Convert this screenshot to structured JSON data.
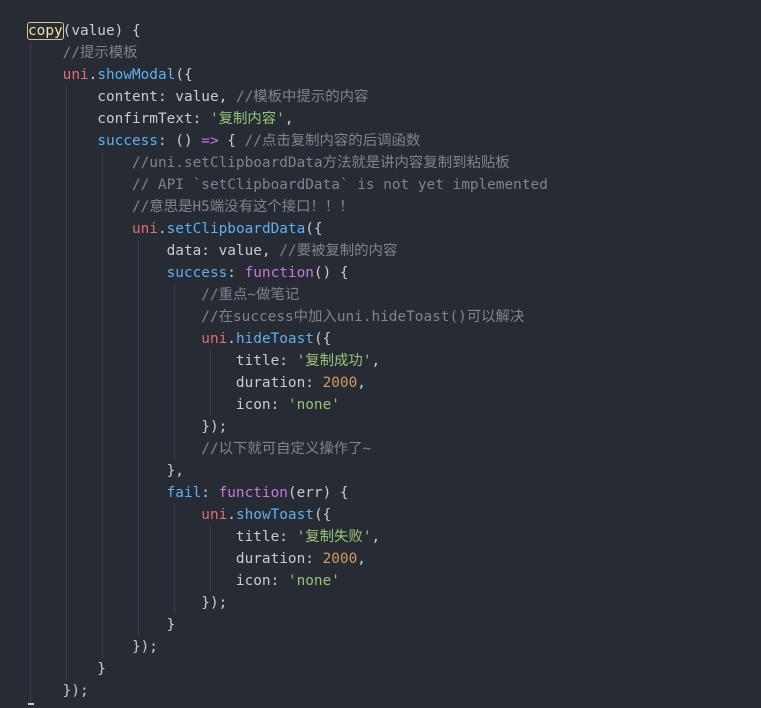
{
  "code": {
    "lines": [
      [
        {
          "t": "copy",
          "c": "hl"
        },
        {
          "t": "(value) {",
          "c": "plain"
        }
      ],
      [
        {
          "t": "    //提示模板",
          "c": "comment"
        }
      ],
      [
        {
          "t": "    ",
          "c": "plain"
        },
        {
          "t": "uni",
          "c": "obj"
        },
        {
          "t": ".",
          "c": "punc"
        },
        {
          "t": "showModal",
          "c": "method"
        },
        {
          "t": "({",
          "c": "punc"
        }
      ],
      [
        {
          "t": "        content: value, ",
          "c": "prop"
        },
        {
          "t": "//模板中提示的内容",
          "c": "comment"
        }
      ],
      [
        {
          "t": "        confirmText: ",
          "c": "prop"
        },
        {
          "t": "'复制内容'",
          "c": "string"
        },
        {
          "t": ",",
          "c": "punc"
        }
      ],
      [
        {
          "t": "        ",
          "c": "plain"
        },
        {
          "t": "success",
          "c": "key"
        },
        {
          "t": ": () ",
          "c": "punc"
        },
        {
          "t": "=>",
          "c": "op"
        },
        {
          "t": " { ",
          "c": "punc"
        },
        {
          "t": "//点击复制内容的后调函数",
          "c": "comment"
        }
      ],
      [
        {
          "t": "            //uni.setClipboardData方法就是讲内容复制到粘贴板",
          "c": "comment"
        }
      ],
      [
        {
          "t": "            // API `setClipboardData` is not yet implemented",
          "c": "comment"
        }
      ],
      [
        {
          "t": "            //意思是H5端没有这个接口！！！",
          "c": "comment"
        }
      ],
      [
        {
          "t": "            ",
          "c": "plain"
        },
        {
          "t": "uni",
          "c": "obj"
        },
        {
          "t": ".",
          "c": "punc"
        },
        {
          "t": "setClipboardData",
          "c": "method"
        },
        {
          "t": "({",
          "c": "punc"
        }
      ],
      [
        {
          "t": "                data: value, ",
          "c": "prop"
        },
        {
          "t": "//要被复制的内容",
          "c": "comment"
        }
      ],
      [
        {
          "t": "                ",
          "c": "plain"
        },
        {
          "t": "success",
          "c": "key"
        },
        {
          "t": ": ",
          "c": "punc"
        },
        {
          "t": "function",
          "c": "kw"
        },
        {
          "t": "() {",
          "c": "punc"
        }
      ],
      [
        {
          "t": "                    //重点~做笔记",
          "c": "comment"
        }
      ],
      [
        {
          "t": "                    //在success中加入uni.hideToast()可以解决",
          "c": "comment"
        }
      ],
      [
        {
          "t": "                    ",
          "c": "plain"
        },
        {
          "t": "uni",
          "c": "obj"
        },
        {
          "t": ".",
          "c": "punc"
        },
        {
          "t": "hideToast",
          "c": "method"
        },
        {
          "t": "({",
          "c": "punc"
        }
      ],
      [
        {
          "t": "                        title: ",
          "c": "prop"
        },
        {
          "t": "'复制成功'",
          "c": "string"
        },
        {
          "t": ",",
          "c": "punc"
        }
      ],
      [
        {
          "t": "                        duration: ",
          "c": "prop"
        },
        {
          "t": "2000",
          "c": "number"
        },
        {
          "t": ",",
          "c": "punc"
        }
      ],
      [
        {
          "t": "                        icon: ",
          "c": "prop"
        },
        {
          "t": "'none'",
          "c": "string"
        }
      ],
      [
        {
          "t": "                    });",
          "c": "punc"
        }
      ],
      [
        {
          "t": "                    //以下就可自定义操作了~",
          "c": "comment"
        }
      ],
      [
        {
          "t": "                },",
          "c": "punc"
        }
      ],
      [
        {
          "t": "                ",
          "c": "plain"
        },
        {
          "t": "fail",
          "c": "key"
        },
        {
          "t": ": ",
          "c": "punc"
        },
        {
          "t": "function",
          "c": "kw"
        },
        {
          "t": "(err) {",
          "c": "punc"
        }
      ],
      [
        {
          "t": "                    ",
          "c": "plain"
        },
        {
          "t": "uni",
          "c": "obj"
        },
        {
          "t": ".",
          "c": "punc"
        },
        {
          "t": "showToast",
          "c": "method"
        },
        {
          "t": "({",
          "c": "punc"
        }
      ],
      [
        {
          "t": "                        title: ",
          "c": "prop"
        },
        {
          "t": "'复制失败'",
          "c": "string"
        },
        {
          "t": ",",
          "c": "punc"
        }
      ],
      [
        {
          "t": "                        duration: ",
          "c": "prop"
        },
        {
          "t": "2000",
          "c": "number"
        },
        {
          "t": ",",
          "c": "punc"
        }
      ],
      [
        {
          "t": "                        icon: ",
          "c": "prop"
        },
        {
          "t": "'none'",
          "c": "string"
        }
      ],
      [
        {
          "t": "                    });",
          "c": "punc"
        }
      ],
      [
        {
          "t": "                }",
          "c": "punc"
        }
      ],
      [
        {
          "t": "            });",
          "c": "punc"
        }
      ],
      [
        {
          "t": "        }",
          "c": "punc"
        }
      ],
      [
        {
          "t": "    });",
          "c": "punc"
        }
      ]
    ]
  },
  "colors": {
    "background": "#272b33",
    "comment": "#7f848e",
    "object": "#e06c75",
    "method": "#61afef",
    "string": "#98c379",
    "number": "#d19a66",
    "keyword": "#c678dd",
    "highlight": "#e5c07b"
  }
}
